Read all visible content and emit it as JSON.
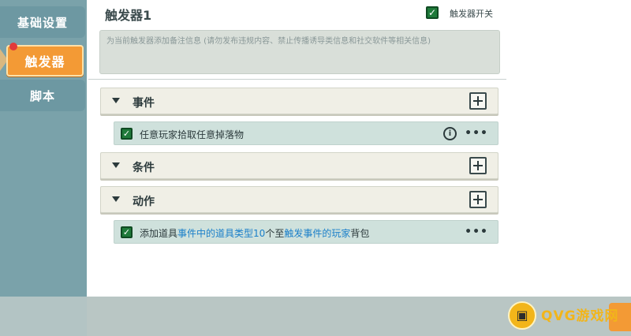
{
  "sidebar": {
    "tabs": [
      {
        "label": "基础设置"
      },
      {
        "label": "触发器"
      },
      {
        "label": "脚本"
      }
    ]
  },
  "trigger": {
    "title": "触发器1",
    "switch_label": "触发器开关",
    "note_placeholder": "为当前触发器添加备注信息 (请勿发布违规内容、禁止传播诱导类信息和社交软件等相关信息)"
  },
  "sections": [
    {
      "label": "事件",
      "entries": [
        {
          "text": "任意玩家拾取任意掉落物"
        }
      ]
    },
    {
      "label": "条件",
      "entries": []
    },
    {
      "label": "动作",
      "entries": [
        {
          "parts": [
            "添加道具",
            "事件中的道具类型",
            "10",
            "个至",
            "触发事件的玩家",
            "背包"
          ]
        }
      ]
    }
  ],
  "logo": {
    "text": "QVG游戏网",
    "badge": "▣"
  },
  "icons": {
    "check": "✓",
    "info": "i",
    "more": "•••"
  },
  "colors": {
    "accent_orange": "#f39a35",
    "check_green": "#1f7a3a",
    "highlight_blue": "#1a7fc9"
  }
}
